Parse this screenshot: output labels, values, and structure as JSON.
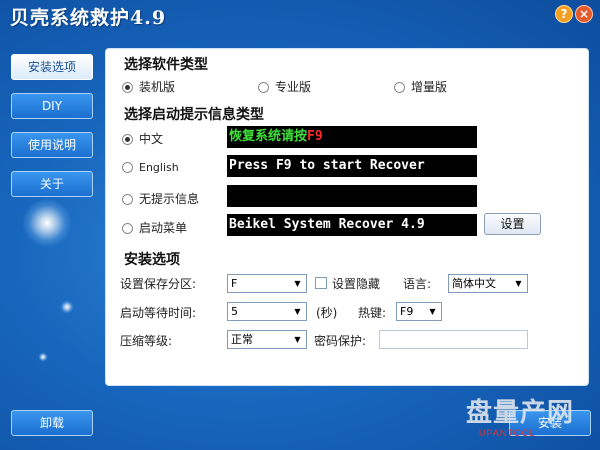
{
  "window": {
    "title": "贝壳系统救护4.9",
    "help_label": "?",
    "close_label": "×"
  },
  "nav": {
    "items": [
      {
        "label": "安装选项",
        "active": true
      },
      {
        "label": "DIY",
        "active": false
      },
      {
        "label": "使用说明",
        "active": false
      },
      {
        "label": "关于",
        "active": false
      }
    ]
  },
  "software_type": {
    "heading": "选择软件类型",
    "options": [
      "装机版",
      "专业版",
      "增量版"
    ],
    "selected": "装机版"
  },
  "boot_prompt": {
    "heading": "选择启动提示信息类型",
    "options": [
      {
        "label": "中文",
        "selected": true,
        "preview_green": "恢复系统请按",
        "preview_red": "F9"
      },
      {
        "label": "English",
        "selected": false,
        "preview": "Press F9 to start Recover"
      },
      {
        "label": "无提示信息",
        "selected": false,
        "preview": ""
      },
      {
        "label": "启动菜单",
        "selected": false,
        "preview": "Beikel System Recover 4.9"
      }
    ],
    "settings_button": "设置"
  },
  "install_options": {
    "heading": "安装选项",
    "save_partition_label": "设置保存分区:",
    "save_partition_value": "F",
    "hide_setting_label": "设置隐藏",
    "hide_setting_checked": false,
    "language_label": "语言:",
    "language_value": "简体中文",
    "wait_time_label": "启动等待时间:",
    "wait_time_value": "5",
    "seconds_label": "(秒)",
    "hotkey_label": "热键:",
    "hotkey_value": "F9",
    "compression_label": "压缩等级:",
    "compression_value": "正常",
    "password_label": "密码保护:",
    "password_value": ""
  },
  "footer": {
    "uninstall_label": "卸载",
    "install_label": "安装"
  },
  "watermark": {
    "text": "盘量产网",
    "sub": "UPANTOOL"
  },
  "colors": {
    "background": "#1766bd",
    "preview_green": "#3fe03a",
    "preview_red": "#ff2a2a"
  }
}
